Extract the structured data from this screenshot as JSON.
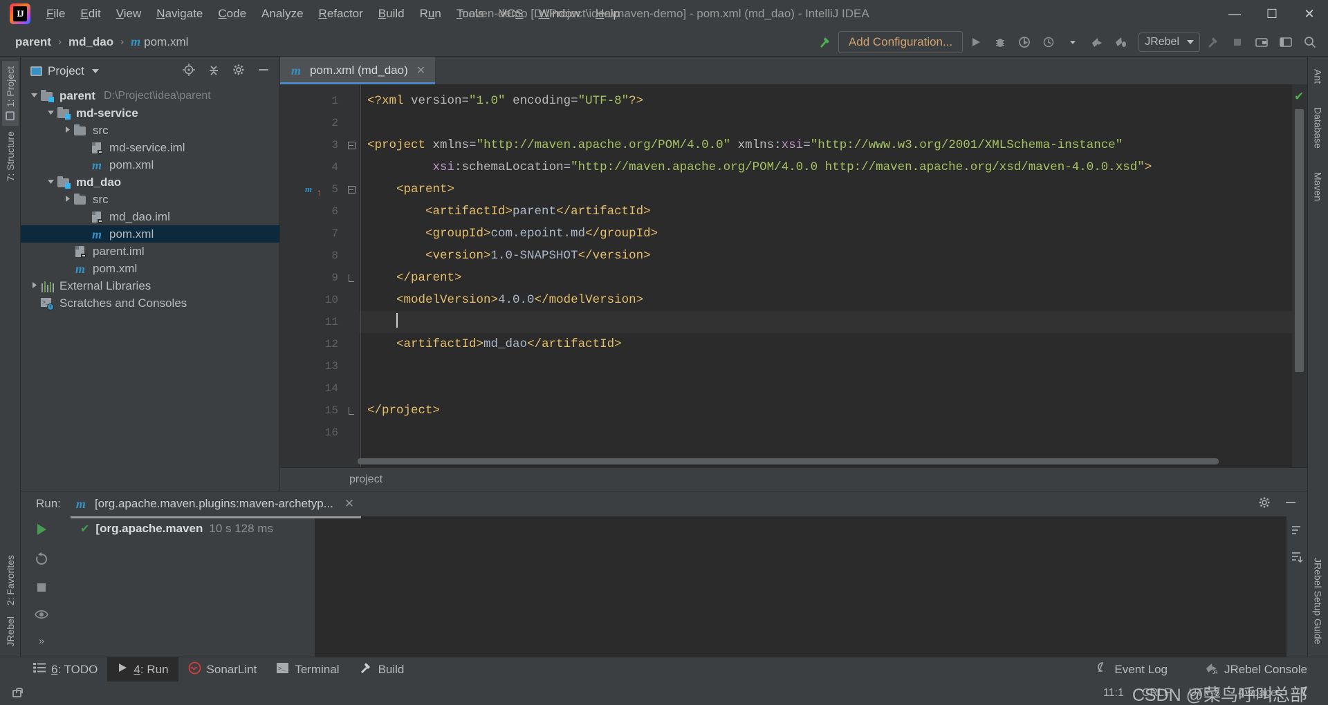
{
  "window": {
    "title": "maven-demo [D:\\Project\\idea\\maven-demo] - pom.xml (md_dao) - IntelliJ IDEA",
    "minimize": "—",
    "maximize": "☐",
    "close": "✕"
  },
  "menubar": {
    "items": [
      "File",
      "Edit",
      "View",
      "Navigate",
      "Code",
      "Analyze",
      "Refactor",
      "Build",
      "Run",
      "Tools",
      "VCS",
      "Window",
      "Help"
    ]
  },
  "navbar": {
    "breadcrumbs": [
      "parent",
      "md_dao",
      "pom.xml"
    ],
    "separator": "›",
    "add_configuration": "Add Configuration...",
    "jrebel_label": "JRebel",
    "icons": [
      "build-icon",
      "run-icon",
      "debug-icon",
      "run-with-coverage-icon",
      "profiler-icon",
      "dropdown-icon",
      "jrebel-run-icon",
      "jrebel-debug-icon",
      "stop-icon",
      "hammer-icon",
      "updates-icon",
      "settings-icon",
      "search-icon"
    ]
  },
  "left_tool_strip": {
    "top": [
      "1: Project",
      "7: Structure"
    ],
    "bottom": [
      "2: Favorites",
      "JRebel"
    ]
  },
  "right_tool_strip": {
    "items": [
      "Ant",
      "Database",
      "Maven"
    ]
  },
  "project_panel": {
    "title": "Project",
    "locate_icon": "locate-icon",
    "collapse_icon": "collapse-all-icon",
    "settings_icon": "gear-icon",
    "hide_icon": "hide-icon",
    "tree": [
      {
        "label": "parent",
        "path": "D:\\Project\\idea\\parent",
        "indent": 0,
        "arrow": "down",
        "icon": "module-folder-icon",
        "bold": true,
        "selected": false
      },
      {
        "label": "md-service",
        "path": "",
        "indent": 1,
        "arrow": "down",
        "icon": "module-folder-icon",
        "bold": true,
        "selected": false
      },
      {
        "label": "src",
        "path": "",
        "indent": 2,
        "arrow": "right",
        "icon": "folder-icon",
        "bold": false,
        "selected": false
      },
      {
        "label": "md-service.iml",
        "path": "",
        "indent": 3,
        "arrow": "none",
        "icon": "iml-file-icon",
        "bold": false,
        "selected": false
      },
      {
        "label": "pom.xml",
        "path": "",
        "indent": 3,
        "arrow": "none",
        "icon": "maven-file-icon",
        "bold": false,
        "selected": false
      },
      {
        "label": "md_dao",
        "path": "",
        "indent": 1,
        "arrow": "down",
        "icon": "module-folder-icon",
        "bold": true,
        "selected": false
      },
      {
        "label": "src",
        "path": "",
        "indent": 2,
        "arrow": "right",
        "icon": "folder-icon",
        "bold": false,
        "selected": false
      },
      {
        "label": "md_dao.iml",
        "path": "",
        "indent": 3,
        "arrow": "none",
        "icon": "iml-file-icon",
        "bold": false,
        "selected": false
      },
      {
        "label": "pom.xml",
        "path": "",
        "indent": 3,
        "arrow": "none",
        "icon": "maven-file-icon",
        "bold": false,
        "selected": true
      },
      {
        "label": "parent.iml",
        "path": "",
        "indent": 2,
        "arrow": "none",
        "icon": "iml-file-icon",
        "bold": false,
        "selected": false
      },
      {
        "label": "pom.xml",
        "path": "",
        "indent": 2,
        "arrow": "none",
        "icon": "maven-file-icon",
        "bold": false,
        "selected": false
      },
      {
        "label": "External Libraries",
        "path": "",
        "indent": 0,
        "arrow": "right",
        "icon": "libraries-icon",
        "bold": false,
        "selected": false
      },
      {
        "label": "Scratches and Consoles",
        "path": "",
        "indent": 0,
        "arrow": "none",
        "icon": "scratches-icon",
        "bold": false,
        "selected": false
      }
    ]
  },
  "editor": {
    "tab": {
      "label": "pom.xml (md_dao)",
      "icon": "maven-file-icon",
      "close": "✕"
    },
    "breadcrumb": "project",
    "inspection_status": "✔",
    "lines": [
      {
        "n": 1,
        "gutter_mark": "",
        "fold": "",
        "indent": 0,
        "tokens": [
          {
            "t": "<?xml ",
            "c": "k-pi"
          },
          {
            "t": "version",
            "c": "k-attr"
          },
          {
            "t": "=",
            "c": "k-txt"
          },
          {
            "t": "\"1.0\"",
            "c": "k-val"
          },
          {
            "t": " ",
            "c": "k-txt"
          },
          {
            "t": "encoding",
            "c": "k-attr"
          },
          {
            "t": "=",
            "c": "k-txt"
          },
          {
            "t": "\"UTF-8\"",
            "c": "k-val"
          },
          {
            "t": "?>",
            "c": "k-pi"
          }
        ]
      },
      {
        "n": 2,
        "gutter_mark": "",
        "fold": "",
        "indent": 0,
        "tokens": []
      },
      {
        "n": 3,
        "gutter_mark": "",
        "fold": "minus",
        "indent": 0,
        "tokens": [
          {
            "t": "<project",
            "c": "k-tag"
          },
          {
            "t": " ",
            "c": "k-txt"
          },
          {
            "t": "xmlns",
            "c": "k-attr"
          },
          {
            "t": "=",
            "c": "k-txt"
          },
          {
            "t": "\"http://maven.apache.org/POM/4.0.0\"",
            "c": "k-val"
          },
          {
            "t": " ",
            "c": "k-txt"
          },
          {
            "t": "xmlns",
            "c": "k-attr"
          },
          {
            "t": ":",
            "c": "k-txt"
          },
          {
            "t": "xsi",
            "c": "k-ns"
          },
          {
            "t": "=",
            "c": "k-txt"
          },
          {
            "t": "\"http://www.w3.org/2001/XMLSchema-instance\"",
            "c": "k-val"
          }
        ]
      },
      {
        "n": 4,
        "gutter_mark": "",
        "fold": "",
        "indent": 0,
        "tokens": [
          {
            "t": "         ",
            "c": "k-txt"
          },
          {
            "t": "xsi",
            "c": "k-ns"
          },
          {
            "t": ":",
            "c": "k-txt"
          },
          {
            "t": "schemaLocation",
            "c": "k-attr"
          },
          {
            "t": "=",
            "c": "k-txt"
          },
          {
            "t": "\"http://maven.apache.org/POM/4.0.0 http://maven.apache.org/xsd/maven-4.0.0.xsd\"",
            "c": "k-val"
          },
          {
            "t": ">",
            "c": "k-tag"
          }
        ]
      },
      {
        "n": 5,
        "gutter_mark": "m",
        "fold": "minus",
        "indent": 0,
        "tokens": [
          {
            "t": "    ",
            "c": "k-txt"
          },
          {
            "t": "<parent>",
            "c": "k-tag"
          }
        ]
      },
      {
        "n": 6,
        "gutter_mark": "",
        "fold": "",
        "indent": 0,
        "tokens": [
          {
            "t": "        ",
            "c": "k-txt"
          },
          {
            "t": "<artifactId>",
            "c": "k-tag"
          },
          {
            "t": "parent",
            "c": "k-txt"
          },
          {
            "t": "</artifactId>",
            "c": "k-tag"
          }
        ]
      },
      {
        "n": 7,
        "gutter_mark": "",
        "fold": "",
        "indent": 0,
        "tokens": [
          {
            "t": "        ",
            "c": "k-txt"
          },
          {
            "t": "<groupId>",
            "c": "k-tag"
          },
          {
            "t": "com.epoint.md",
            "c": "k-txt"
          },
          {
            "t": "</groupId>",
            "c": "k-tag"
          }
        ]
      },
      {
        "n": 8,
        "gutter_mark": "",
        "fold": "",
        "indent": 0,
        "tokens": [
          {
            "t": "        ",
            "c": "k-txt"
          },
          {
            "t": "<version>",
            "c": "k-tag"
          },
          {
            "t": "1.0-SNAPSHOT",
            "c": "k-txt"
          },
          {
            "t": "</version>",
            "c": "k-tag"
          }
        ]
      },
      {
        "n": 9,
        "gutter_mark": "",
        "fold": "end",
        "indent": 0,
        "tokens": [
          {
            "t": "    ",
            "c": "k-txt"
          },
          {
            "t": "</parent>",
            "c": "k-tag"
          }
        ]
      },
      {
        "n": 10,
        "gutter_mark": "",
        "fold": "",
        "indent": 0,
        "tokens": [
          {
            "t": "    ",
            "c": "k-txt"
          },
          {
            "t": "<modelVersion>",
            "c": "k-tag"
          },
          {
            "t": "4.0.0",
            "c": "k-txt"
          },
          {
            "t": "</modelVersion>",
            "c": "k-tag"
          }
        ]
      },
      {
        "n": 11,
        "gutter_mark": "",
        "fold": "",
        "indent": 0,
        "current": true,
        "caret": true,
        "tokens": [
          {
            "t": "    ",
            "c": "k-txt"
          }
        ]
      },
      {
        "n": 12,
        "gutter_mark": "",
        "fold": "",
        "indent": 0,
        "tokens": [
          {
            "t": "    ",
            "c": "k-txt"
          },
          {
            "t": "<artifactId>",
            "c": "k-tag"
          },
          {
            "t": "md_dao",
            "c": "k-txt"
          },
          {
            "t": "</artifactId>",
            "c": "k-tag"
          }
        ]
      },
      {
        "n": 13,
        "gutter_mark": "",
        "fold": "",
        "indent": 0,
        "tokens": []
      },
      {
        "n": 14,
        "gutter_mark": "",
        "fold": "",
        "indent": 0,
        "tokens": []
      },
      {
        "n": 15,
        "gutter_mark": "",
        "fold": "end",
        "indent": 0,
        "tokens": [
          {
            "t": "</project>",
            "c": "k-tag"
          }
        ]
      },
      {
        "n": 16,
        "gutter_mark": "",
        "fold": "",
        "indent": 0,
        "tokens": []
      }
    ]
  },
  "run_window": {
    "label": "Run:",
    "tab": {
      "icon": "maven-file-icon",
      "label": "[org.apache.maven.plugins:maven-archetyp...",
      "close": "✕"
    },
    "settings_icon": "gear-icon",
    "hide_icon": "hide-icon",
    "side_buttons": [
      "rerun-icon",
      "rerun-failed-icon",
      "stop-icon",
      "toggle-visibility-icon",
      "expand-icon"
    ],
    "results": [
      {
        "status": "✔",
        "name": "[org.apache.maven",
        "time": "10 s 128 ms"
      }
    ],
    "right_buttons": [
      "sort-icon",
      "export-icon"
    ]
  },
  "bottom_bar": {
    "left": [
      {
        "label": "6: TODO",
        "mnemonic": "6",
        "icon": "todo-icon",
        "active": false
      },
      {
        "label": "4: Run",
        "mnemonic": "4",
        "icon": "run-icon",
        "active": true
      },
      {
        "label": "SonarLint",
        "mnemonic": "",
        "icon": "sonarlint-icon",
        "active": false
      },
      {
        "label": "Terminal",
        "mnemonic": "",
        "icon": "terminal-icon",
        "active": false
      },
      {
        "label": "Build",
        "mnemonic": "",
        "icon": "hammer-icon",
        "active": false
      }
    ],
    "right": [
      {
        "label": "Event Log",
        "icon": "event-log-icon"
      },
      {
        "label": "JRebel Console",
        "icon": "jrebel-icon"
      }
    ]
  },
  "status_bar": {
    "caret_position": "11:1",
    "line_separator": "CRLF",
    "encoding": "UTF-8",
    "indent": "4 spaces",
    "lock_icon": "lock-icon",
    "watermark": "CSDN @菜鸟呼叫总部"
  },
  "colors": {
    "accent": "#4a88c7",
    "selection": "#0d293e",
    "editor_bg": "#2b2b2b",
    "panel_bg": "#3c3f41",
    "tag": "#e8bf6a",
    "value": "#a5c261",
    "namespace": "#bd93c9",
    "text": "#a9b7c6",
    "success": "#4caf50"
  }
}
